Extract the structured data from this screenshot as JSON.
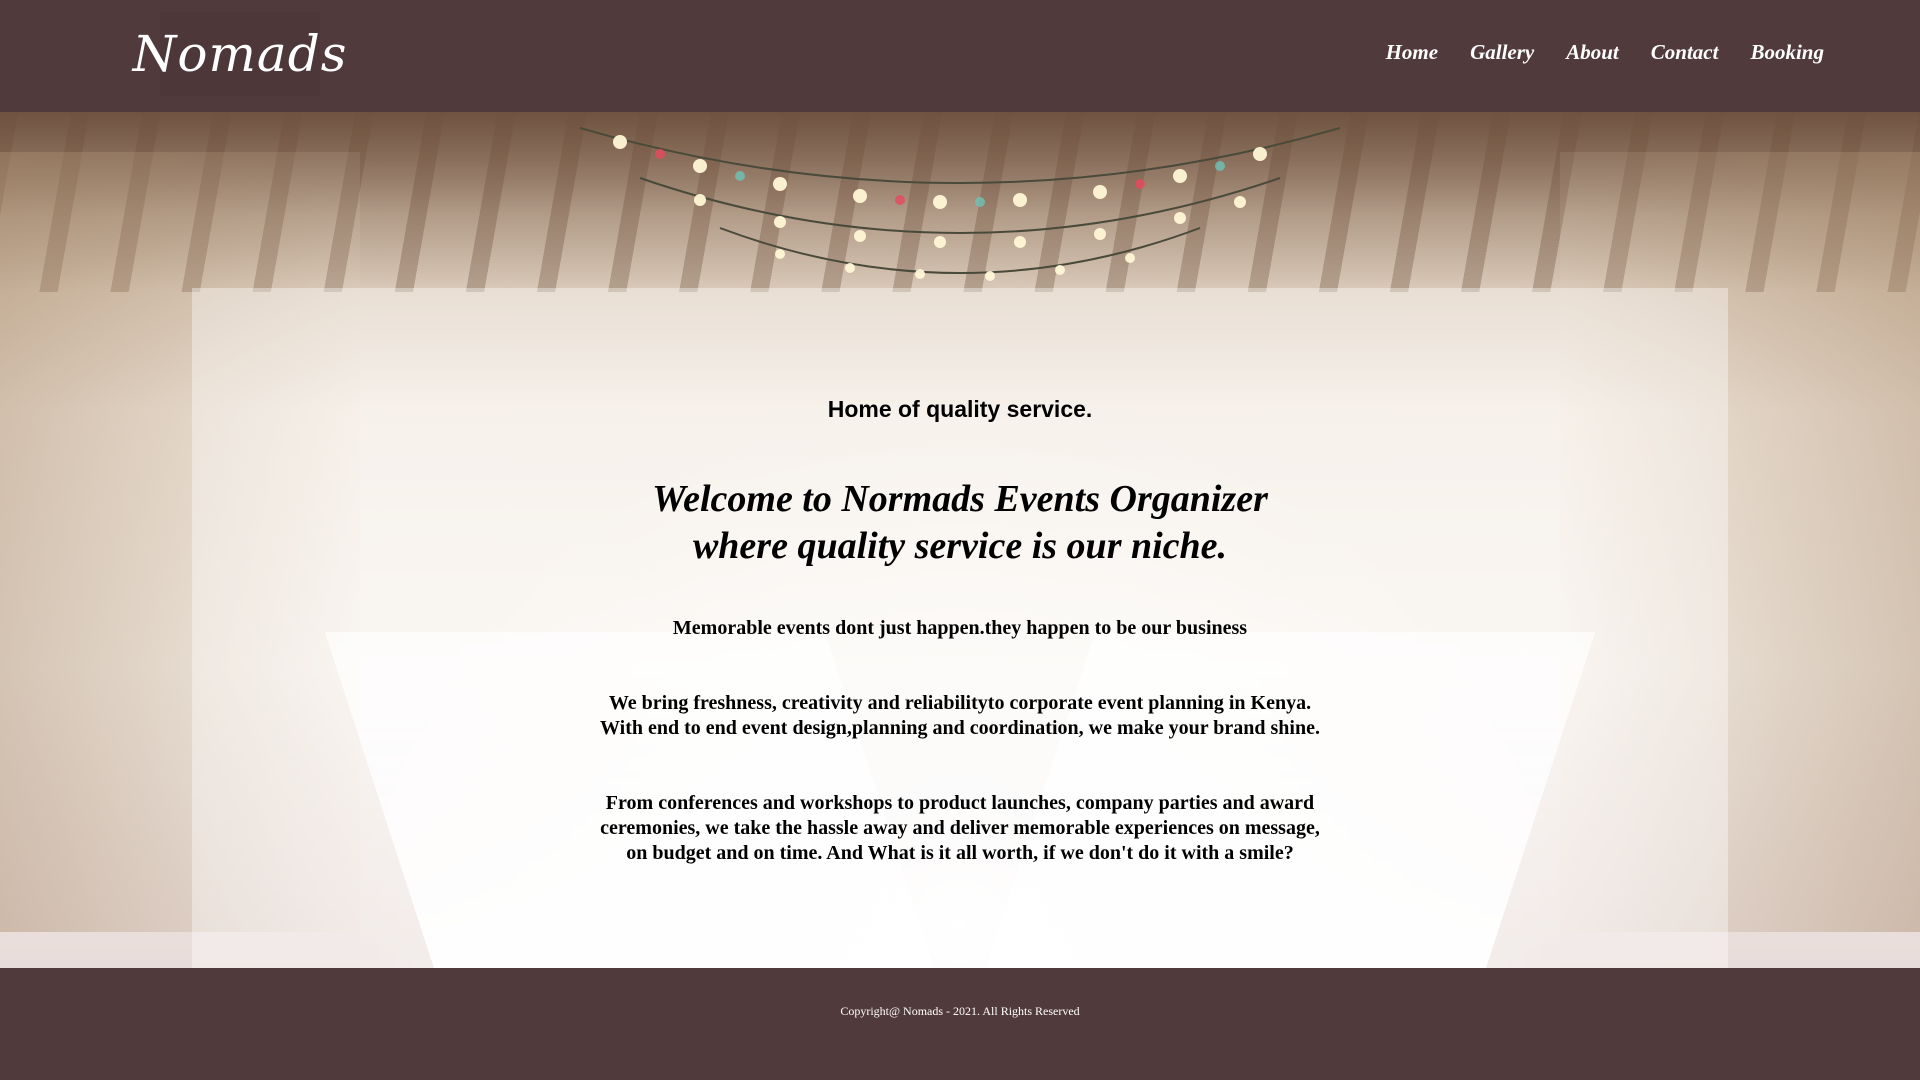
{
  "brand": {
    "logo_text": "Nomads"
  },
  "nav": {
    "items": [
      {
        "label": "Home"
      },
      {
        "label": "Gallery"
      },
      {
        "label": "About"
      },
      {
        "label": "Contact"
      },
      {
        "label": "Booking"
      }
    ]
  },
  "hero": {
    "tagline": "Home of quality service.",
    "welcome_line1": "Welcome to Normads Events Organizer",
    "welcome_line2": "where quality service is our niche.",
    "paragraph1": "Memorable events dont just happen.they happen to be our business",
    "paragraph2_line1": "We bring freshness, creativity and reliabilityto corporate event planning in Kenya.",
    "paragraph2_line2": "With end to end event design,planning and coordination, we make your brand shine.",
    "paragraph3_line1": "From conferences and workshops to product launches, company parties and award",
    "paragraph3_line2": "ceremonies, we take the hassle away and deliver memorable experiences on message,",
    "paragraph3_line3": "on budget and on time. And What is it all worth, if we don't do it with a smile?"
  },
  "footer": {
    "copyright": "Copyright@ Nomads - 2021. All Rights Reserved"
  },
  "colors": {
    "header_bg": "#513a3c",
    "footer_bg": "#513a3c",
    "nav_text": "#ffffff",
    "overlay": "rgba(255,255,255,0.38)"
  },
  "background_image": "banquet-hall-with-long-white-tables-and-string-lights"
}
